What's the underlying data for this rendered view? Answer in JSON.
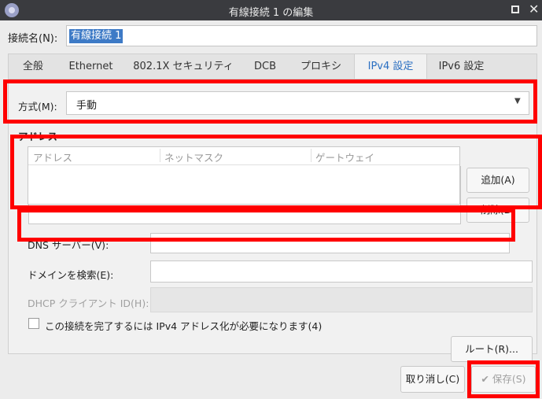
{
  "window": {
    "title": "有線接続 1 の編集"
  },
  "connection_name": {
    "label": "接続名(N):",
    "value": "有線接続 1"
  },
  "tabs": [
    {
      "label": "全般"
    },
    {
      "label": "Ethernet"
    },
    {
      "label": "802.1X セキュリティ"
    },
    {
      "label": "DCB"
    },
    {
      "label": "プロキシ"
    },
    {
      "label": "IPv4 設定",
      "active": true
    },
    {
      "label": "IPv6 設定"
    }
  ],
  "ipv4": {
    "method_label": "方式(M):",
    "method_value": "手動",
    "address_section_label": "アドレス",
    "address_columns": [
      "アドレス",
      "ネットマスク",
      "ゲートウェイ"
    ],
    "add_button": "追加(A)",
    "delete_button": "削除(D)",
    "dns_label": "DNS サーバー(V):",
    "dns_value": "",
    "search_domains_label": "ドメインを検索(E):",
    "search_domains_value": "",
    "dhcp_client_id_label": "DHCP クライアント ID(H):",
    "require_ipv4_label": "この接続を完了するには IPv4 アドレス化が必要になります(4)",
    "require_ipv4_checked": false,
    "routes_button": "ルート(R)..."
  },
  "footer": {
    "cancel_button": "取り消し(C)",
    "save_button": "保存(S)"
  },
  "colors": {
    "highlight": "#ff0000",
    "accent": "#3d7ac6",
    "titlebar": "#3a3b3f"
  }
}
